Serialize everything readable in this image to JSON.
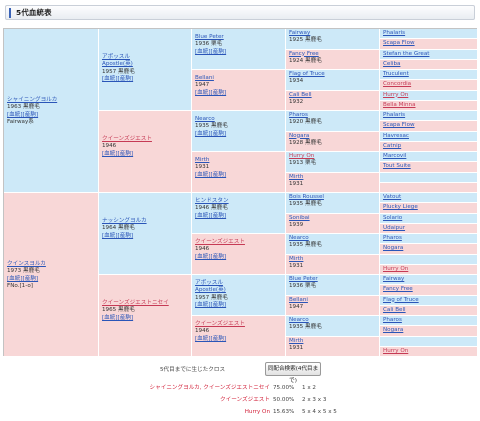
{
  "title": "5代血統表",
  "gen1": {
    "sire": {
      "name": "シャイニングヨルカ",
      "line1": "1963 黒鹿毛",
      "link": "[血統][産駒]",
      "line2": "Fairway系"
    },
    "dam": {
      "name": "クインスヨルカ",
      "line1": "1973 黒鹿毛",
      "link": "[血統][産駒]",
      "line2": "FNo.[1-o]"
    }
  },
  "gen2": [
    {
      "name": "アポッスル",
      "sub": "Apostle(英)",
      "line1": "1957 黒鹿毛",
      "link": "[血統][産駒]"
    },
    {
      "name": "クイーンズジエスト",
      "line1": "1946",
      "link": "[血統][産駒]"
    },
    {
      "name": "ナッシングヨルカ",
      "line1": "1964 黒鹿毛",
      "link": "[血統][産駒]"
    },
    {
      "name": "クイーンズジエストニセイ",
      "line1": "1965 黒鹿毛",
      "link": "[血統][産駒]"
    }
  ],
  "gen3": [
    {
      "name": "Blue Peter",
      "line1": "1936 栗毛",
      "link": "[血統][産駒]"
    },
    {
      "name": "Bellani",
      "line1": "1947",
      "link": "[血統][産駒]"
    },
    {
      "name": "Nearco",
      "line1": "1935 黒鹿毛",
      "link": "[血統][産駒]"
    },
    {
      "name": "Mirth",
      "line1": "1931",
      "link": "[血統][産駒]"
    },
    {
      "name": "ヒンドスタン",
      "line1": "1946 黒鹿毛",
      "link": "[血統][産駒]"
    },
    {
      "name": "クイーンズジエスト",
      "line1": "1946",
      "link": "[血統][産駒]"
    },
    {
      "name": "アポッスル",
      "sub": "Apostle(英)",
      "line1": "1957 黒鹿毛",
      "link": "[血統][産駒]"
    },
    {
      "name": "クイーンズジエスト",
      "line1": "1946",
      "link": "[血統][産駒]"
    }
  ],
  "gen4": [
    {
      "name": "Fairway",
      "line1": "1925 黒鹿毛"
    },
    {
      "name": "Fancy Free",
      "line1": "1924 黒鹿毛"
    },
    {
      "name": "Flag of Truce",
      "line1": "1934"
    },
    {
      "name": "Cali Bell",
      "line1": "1932"
    },
    {
      "name": "Pharos",
      "line1": "1920 黒鹿毛"
    },
    {
      "name": "Nogara",
      "line1": "1928 黒鹿毛"
    },
    {
      "name": "Hurry On",
      "line1": "1913 栗毛"
    },
    {
      "name": "Mirth",
      "line1": "1931"
    },
    {
      "name": "Bois Roussel",
      "line1": "1935 黒鹿毛"
    },
    {
      "name": "Sonibai",
      "line1": "1939"
    },
    {
      "name": "Nearco",
      "line1": "1935 黒鹿毛"
    },
    {
      "name": "Mirth",
      "line1": "1931"
    },
    {
      "name": "Blue Peter",
      "line1": "1936 栗毛"
    },
    {
      "name": "Bellani",
      "line1": "1947"
    },
    {
      "name": "Nearco",
      "line1": "1935 黒鹿毛"
    },
    {
      "name": "Mirth",
      "line1": "1931"
    }
  ],
  "gen5": [
    "Phalaris",
    "Scapa Flow",
    "Stefan the Great",
    "Celiba",
    "Truculent",
    "Concordia",
    "Hurry On",
    "Bella Minna",
    "Phalaris",
    "Scapa Flow",
    "Havresac",
    "Catnip",
    "Marcovil",
    "Tout Suite",
    "",
    "",
    "Vatout",
    "Plucky Liege",
    "Solario",
    "Udaipur",
    "Pharos",
    "Nogara",
    "",
    "Hurry On",
    "Fairway",
    "Fancy Free",
    "Flag of Truce",
    "Cali Bell",
    "Pharos",
    "Nogara",
    "",
    "Hurry On"
  ],
  "footer": {
    "note": "5代目までに生じたクロス",
    "button": "同配合検索(4代目まで)",
    "crosses": [
      {
        "name": "シャイニングヨルカ, クイーンズジエストニセイ",
        "pct": "75.00%",
        "gen": "1 x 2"
      },
      {
        "name": "クイーンズジエスト",
        "pct": "50.00%",
        "gen": "2 x 3 x 3"
      },
      {
        "name": "Hurry On",
        "pct": "15.63%",
        "gen": "5 x 4 x 5 x 5"
      }
    ]
  }
}
